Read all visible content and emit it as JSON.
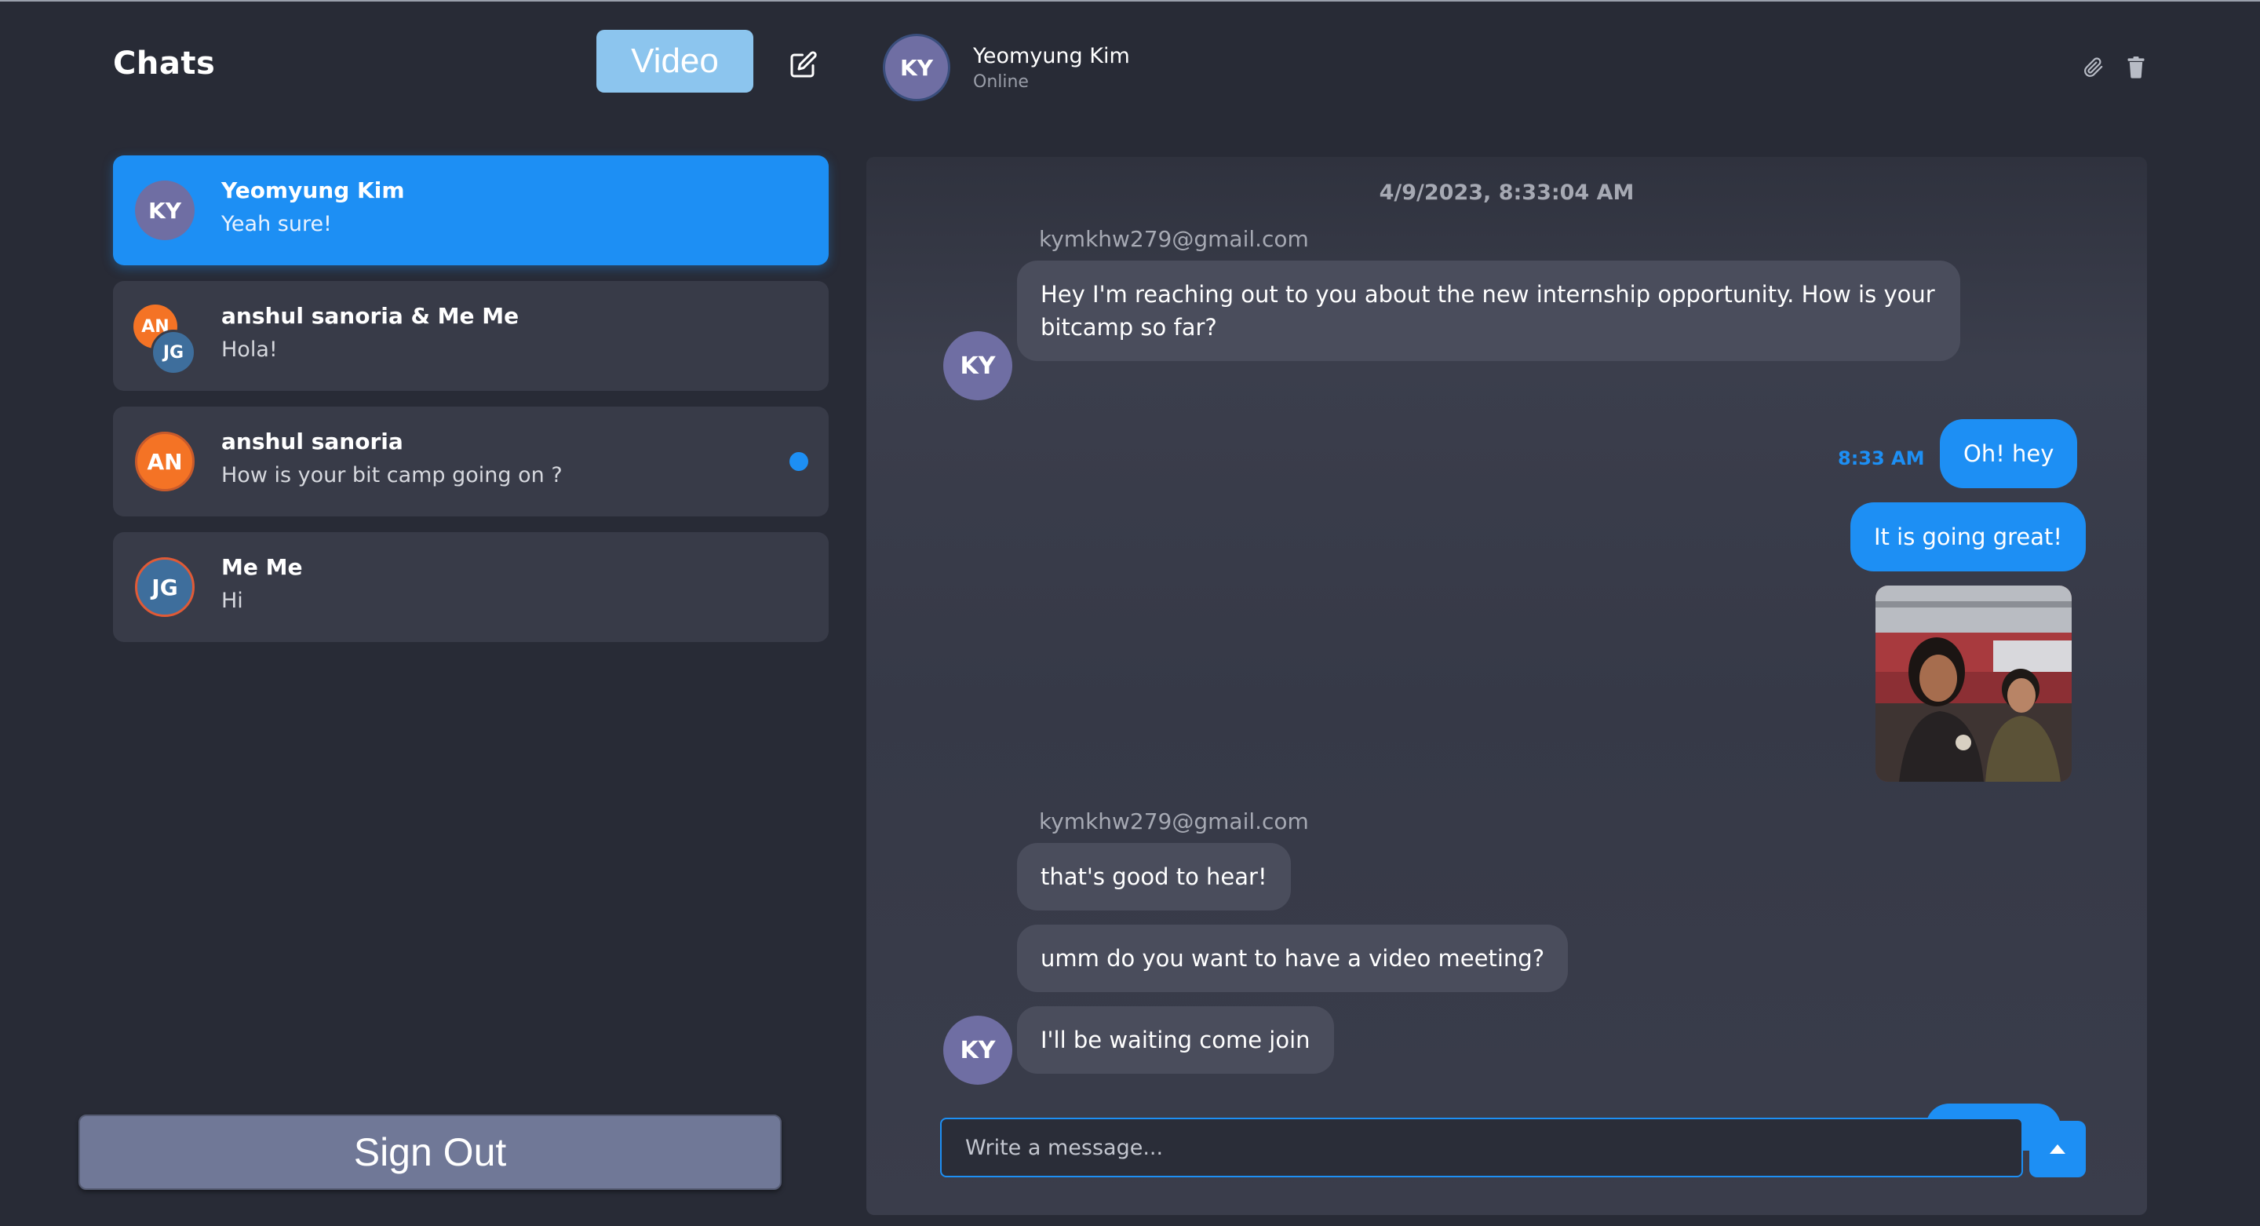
{
  "sidebar": {
    "title": "Chats",
    "video_label": "Video",
    "compose_icon": "edit-icon",
    "signout_label": "Sign Out",
    "chats": [
      {
        "initials": "KY",
        "name": "Yeomyung Kim",
        "preview": "Yeah sure!",
        "active": true
      },
      {
        "initials": [
          "AN",
          "JG"
        ],
        "name": "anshul sanoria & Me Me",
        "preview": "Hola!"
      },
      {
        "initials": "AN",
        "name": "anshul sanoria",
        "preview": "How is your bit camp going on ?",
        "unread": true
      },
      {
        "initials": "JG",
        "name": "Me Me",
        "preview": "Hi"
      }
    ]
  },
  "header": {
    "initials": "KY",
    "name": "Yeomyung Kim",
    "status": "Online",
    "attach_icon": "paperclip-icon",
    "delete_icon": "trash-icon"
  },
  "conversation": {
    "timestamp": "4/9/2023, 8:33:04 AM",
    "messages": [
      {
        "sender": "kymkhw279@gmail.com",
        "direction": "in",
        "text": "Hey I'm reaching out to you about the new internship opportunity. How is your bitcamp so far?",
        "avatar": "KY"
      },
      {
        "direction": "out",
        "time": "8:33 AM",
        "text": "Oh! hey"
      },
      {
        "direction": "out",
        "text": "It is going great!"
      },
      {
        "direction": "out",
        "image": "photo of two people in a stadium"
      },
      {
        "sender": "kymkhw279@gmail.com",
        "direction": "in",
        "text": "that's good to hear!"
      },
      {
        "direction": "in",
        "text": "umm do you want to have a video meeting?"
      },
      {
        "direction": "in",
        "text": "I'll be waiting come join",
        "avatar": "KY"
      }
    ]
  },
  "composer": {
    "placeholder": "Write a message...",
    "send_icon": "send-up-arrow-icon"
  },
  "colors": {
    "background": "#282b36",
    "accent": "#1d8ff4",
    "card": "#383b48",
    "incoming_bubble": "#4a4d5c",
    "video_button": "#8cc5ee",
    "signout_button": "#707897"
  }
}
